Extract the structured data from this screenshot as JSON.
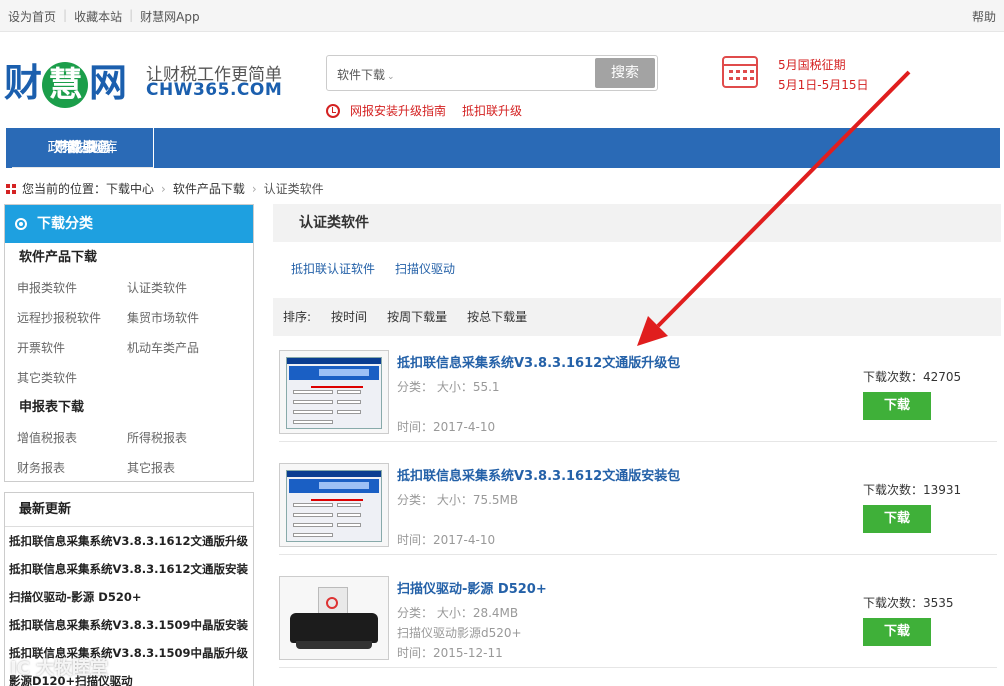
{
  "topbar": {
    "links": [
      "设为首页",
      "收藏本站",
      "财慧网App"
    ],
    "help": "帮助"
  },
  "header": {
    "logo_parts": [
      "财",
      "慧",
      "网"
    ],
    "slogan": "让财税工作更简单",
    "domain": "CHW365.COM",
    "search": {
      "category": "软件下载",
      "placeholder": "",
      "button": "搜索"
    },
    "notices": [
      "网报安装升级指南",
      "抵扣联升级"
    ],
    "tax_period": {
      "title": "5月国税征期",
      "dates": "5月1日-5月15日"
    }
  },
  "nav": [
    "首 页",
    "产品服务",
    "下载中心",
    "政策法规库",
    "财税资讯"
  ],
  "breadcrumb": {
    "label": "您当前的位置：",
    "items": [
      "下载中心",
      "软件产品下载",
      "认证类软件"
    ]
  },
  "sidebar": {
    "title": "下载分类",
    "groups": [
      {
        "name": "软件产品下载",
        "rows": [
          [
            "申报类软件",
            "认证类软件"
          ],
          [
            "远程抄报税软件",
            "集贸市场软件"
          ],
          [
            "开票软件",
            "机动车类产品"
          ],
          [
            "其它类软件"
          ]
        ]
      },
      {
        "name": "申报表下载",
        "rows": [
          [
            "增值税报表",
            "所得税报表"
          ],
          [
            "财务报表",
            "其它报表"
          ]
        ]
      }
    ],
    "latest_title": "最新更新",
    "latest": [
      "抵扣联信息采集系统V3.8.3.1612文通版升级",
      "抵扣联信息采集系统V3.8.3.1612文通版安装",
      "扫描仪驱动-影源 D520+",
      "抵扣联信息采集系统V3.8.3.1509中晶版安装",
      "抵扣联信息采集系统V3.8.3.1509中晶版升级",
      "影源D120+扫描仪驱动"
    ]
  },
  "content": {
    "category": "认证类软件",
    "subcategories": [
      "抵扣联认证软件",
      "扫描仪驱动"
    ],
    "sort": {
      "label": "排序:",
      "options": [
        "按时间",
        "按周下载量",
        "按总下载量"
      ]
    },
    "items": [
      {
        "title": "抵扣联信息采集系统V3.8.3.1612文通版升级包",
        "size": "分类： 大小：55.1",
        "desc": "",
        "time": "时间：2017-4-10",
        "count": "下载次数：42705",
        "button": "下载",
        "thumb": "software-screenshot"
      },
      {
        "title": "抵扣联信息采集系统V3.8.3.1612文通版安装包",
        "size": "分类： 大小：75.5MB",
        "desc": "",
        "time": "时间：2017-4-10",
        "count": "下载次数：13931",
        "button": "下载",
        "thumb": "software-screenshot"
      },
      {
        "title": "扫描仪驱动-影源 D520+",
        "size": "分类： 大小：28.4MB",
        "desc": "扫描仪驱动影源d520+",
        "time": "时间：2015-12-11",
        "count": "下载次数：3535",
        "button": "下载",
        "thumb": "printer-photo"
      }
    ]
  },
  "watermark": "IC 大牧睦堂",
  "colors": {
    "nav": "#2a6ab6",
    "sidebar_head": "#1ea0e0",
    "download": "#3fb039",
    "link": "#2461a8",
    "alert": "#d42222",
    "arrow": "#e01e1e"
  }
}
